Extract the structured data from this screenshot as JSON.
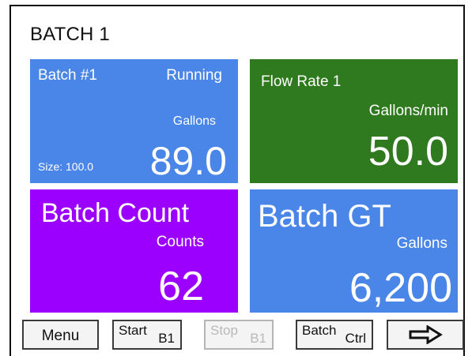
{
  "screen": {
    "title": "BATCH 1"
  },
  "tiles": {
    "batch": {
      "name": "Batch #1",
      "status": "Running",
      "unit": "Gallons",
      "size": "Size: 100.0",
      "value": "89.0",
      "color": "#4a86e8"
    },
    "flow": {
      "name": "Flow Rate 1",
      "unit": "Gallons/min",
      "value": "50.0",
      "color": "#2f7a1e"
    },
    "count": {
      "name": "Batch Count",
      "unit": "Counts",
      "value": "62",
      "color": "#9b00ff"
    },
    "gt": {
      "name": "Batch GT",
      "unit": "Gallons",
      "value": "6,200",
      "color": "#4a86e8"
    }
  },
  "toolbar": {
    "menu_label": "Menu",
    "start_label": "Start",
    "start_sub": "B1",
    "stop_label": "Stop",
    "stop_sub": "B1",
    "batch_label": "Batch",
    "batch_sub": "Ctrl",
    "next_icon": "right-arrow-icon"
  }
}
